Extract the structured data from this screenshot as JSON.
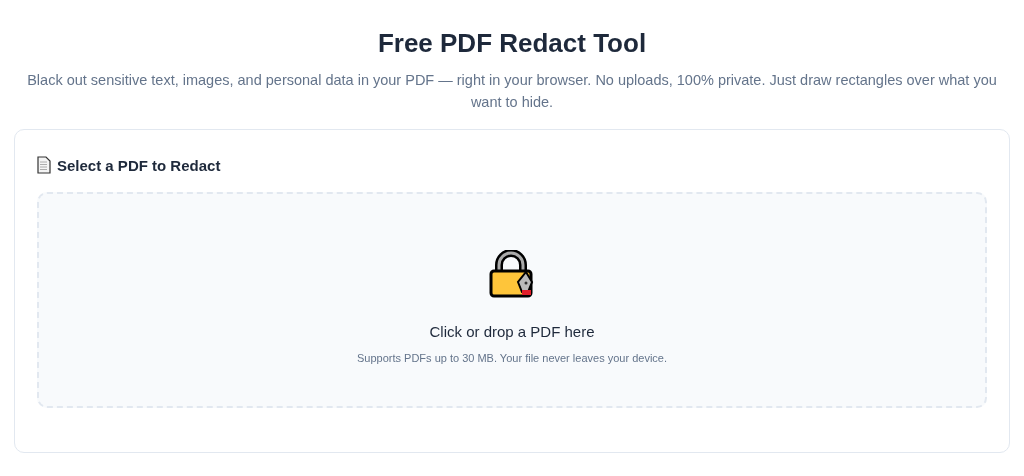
{
  "title": "Free PDF Redact Tool",
  "subtitle": "Black out sensitive text, images, and personal data in your PDF — right in your browser. No uploads, 100% private. Just draw rectangles over what you want to hide.",
  "card": {
    "heading": "Select a PDF to Redact",
    "dropzone": {
      "prompt": "Click or drop a PDF here",
      "hint": "Supports PDFs up to 30 MB. Your file never leaves your device."
    }
  }
}
